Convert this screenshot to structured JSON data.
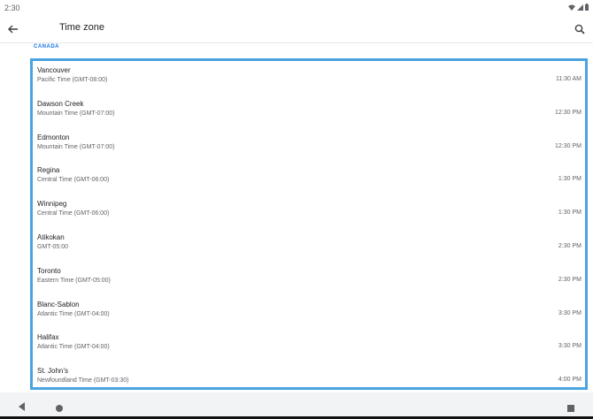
{
  "status_bar": {
    "time": "2:30"
  },
  "app_bar": {
    "title": "Time zone"
  },
  "section": {
    "header": "CANADA"
  },
  "time_zones": [
    {
      "city": "Vancouver",
      "zone": "Pacific Time (GMT-08:00)",
      "time": "11:30 AM"
    },
    {
      "city": "Dawson Creek",
      "zone": "Mountain Time (GMT-07:00)",
      "time": "12:30 PM"
    },
    {
      "city": "Edmonton",
      "zone": "Mountain Time (GMT-07:00)",
      "time": "12:30 PM"
    },
    {
      "city": "Regina",
      "zone": "Central Time (GMT-06:00)",
      "time": "1:30 PM"
    },
    {
      "city": "Winnipeg",
      "zone": "Central Time (GMT-06:00)",
      "time": "1:30 PM"
    },
    {
      "city": "Atikokan",
      "zone": "GMT-05:00",
      "time": "2:30 PM"
    },
    {
      "city": "Toronto",
      "zone": "Eastern Time (GMT-05:00)",
      "time": "2:30 PM"
    },
    {
      "city": "Blanc-Sablon",
      "zone": "Atlantic Time (GMT-04:00)",
      "time": "3:30 PM"
    },
    {
      "city": "Halifax",
      "zone": "Atlantic Time (GMT-04:00)",
      "time": "3:30 PM"
    },
    {
      "city": "St. John’s",
      "zone": "Newfoundland Time (GMT-03:30)",
      "time": "4:00 PM"
    }
  ],
  "colors": {
    "accent": "#1a73e8",
    "selection_border": "#4aa3df"
  },
  "icons": {
    "back": "arrow-back-icon",
    "search": "search-icon",
    "nav_back": "nav-back-icon",
    "nav_home": "nav-home-icon",
    "nav_recent": "nav-recent-icon"
  }
}
